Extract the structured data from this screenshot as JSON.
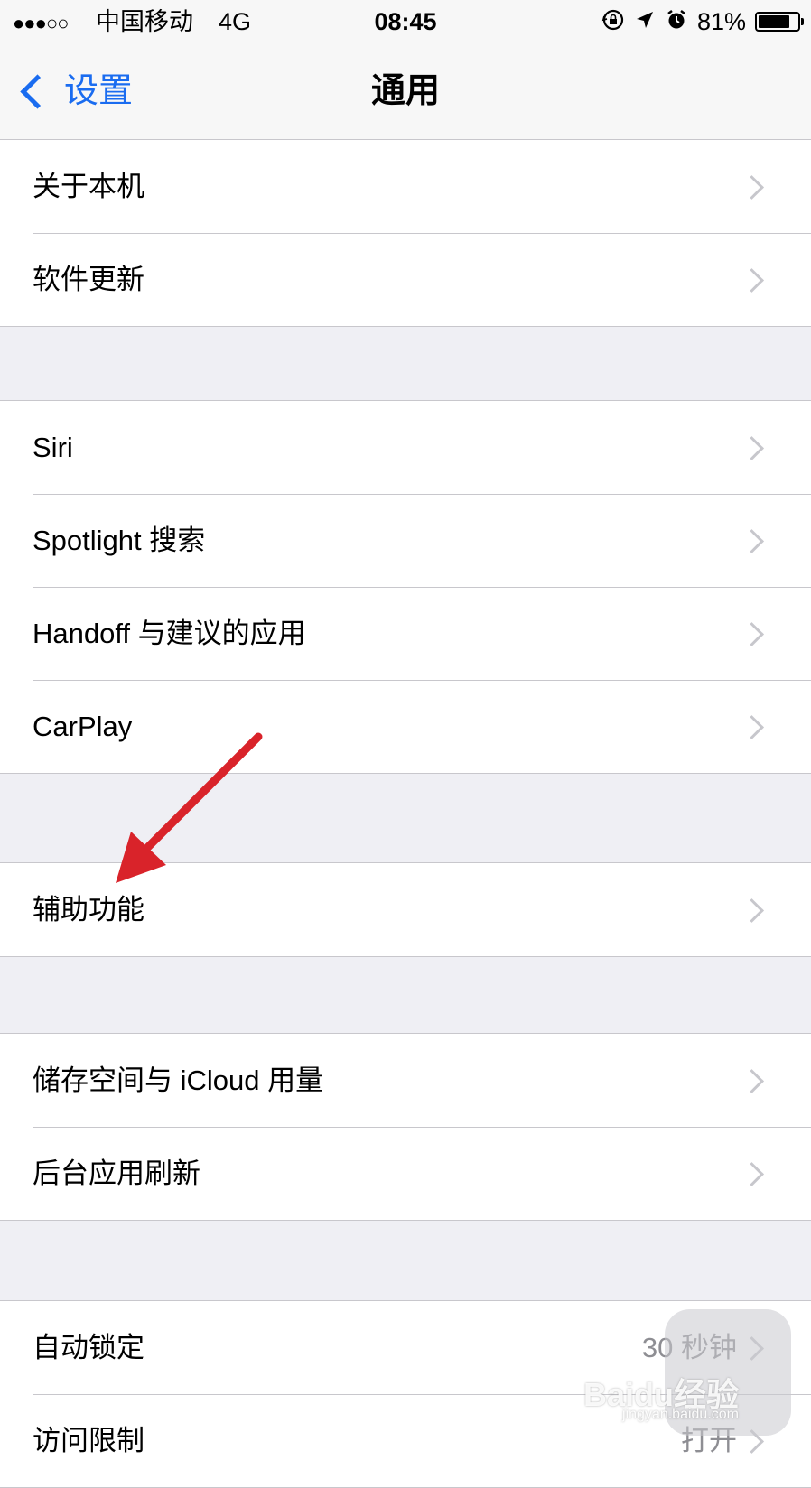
{
  "status_bar": {
    "signal": "●●●○○",
    "carrier": "中国移动",
    "network": "4G",
    "time": "08:45",
    "battery_text": "81%",
    "battery_level": 0.81
  },
  "nav": {
    "back_label": "设置",
    "title": "通用"
  },
  "groups": [
    {
      "items": [
        {
          "label": "关于本机"
        },
        {
          "label": "软件更新"
        }
      ]
    },
    {
      "items": [
        {
          "label": "Siri"
        },
        {
          "label": "Spotlight 搜索"
        },
        {
          "label": "Handoff 与建议的应用"
        },
        {
          "label": "CarPlay"
        }
      ]
    },
    {
      "items": [
        {
          "label": "辅助功能"
        }
      ]
    },
    {
      "items": [
        {
          "label": "储存空间与 iCloud 用量"
        },
        {
          "label": "后台应用刷新"
        }
      ]
    },
    {
      "items": [
        {
          "label": "自动锁定",
          "value": "30 秒钟"
        },
        {
          "label": "访问限制",
          "value": "打开"
        }
      ]
    }
  ],
  "watermark": {
    "logo_text": "Baidu经验",
    "url_text": "jingyan.baidu.com"
  },
  "colors": {
    "accent": "#1a6cf0",
    "annotation_arrow": "#d9232a"
  }
}
